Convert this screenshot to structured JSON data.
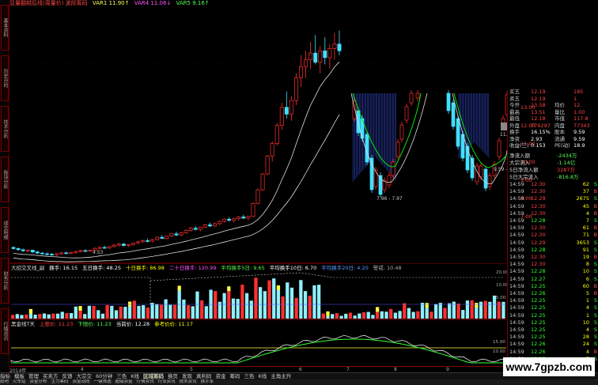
{
  "topbar": {
    "title": "显量翻越后线(周量价)  波段筹码",
    "var1": "VAR1 11.90↑",
    "var4": "VAR4 11.06↓",
    "var5": "VAR5 9.16↑",
    "colors": {
      "title": "#ff4444",
      "var1": "#ffff55",
      "var4": "#ff55ff",
      "var5": "#55ff55"
    }
  },
  "left_strip": [
    "基本资料",
    "历史分时",
    "技术分析",
    "板块分析",
    "成交明细",
    "财务分析",
    "行情资讯"
  ],
  "indicator1": {
    "label": "大招交叉线_副",
    "items": [
      {
        "text": "换手: 16.15",
        "color": "#ffffff"
      },
      {
        "text": "五日换手: 48.25",
        "color": "#ffffff"
      },
      {
        "text": "十日换手: 86.98",
        "color": "#ffff00"
      },
      {
        "text": "二十日换手: 120.99",
        "color": "#ff55ff"
      },
      {
        "text": "平均换手5日: 9.65",
        "color": "#55ff55"
      },
      {
        "text": "平均换手10日: 6.70",
        "color": "#ffffff"
      },
      {
        "text": "平均换手20日: 4.20",
        "color": "#5599ff"
      },
      {
        "text": "警戒: 10.48",
        "color": "#aaaaaa"
      }
    ],
    "yaxis": [
      "20.00",
      "10.00",
      "5.00"
    ]
  },
  "indicator2": {
    "label": "黑金线T天",
    "items": [
      {
        "text": "上限价: 11.23",
        "color": "#ff4444"
      },
      {
        "text": "下限价: 11.23",
        "color": "#55ff55"
      },
      {
        "text": "当前价: 12.28",
        "color": "#ffffff"
      },
      {
        "text": "参考价价: 11.17",
        "color": "#ffff00"
      }
    ],
    "yaxis": [
      "15.00",
      "10.00"
    ]
  },
  "price_labels": [
    "4.53",
    "7.96 - 7.97",
    "11.81 -",
    "9.59 - 9.60"
  ],
  "right_panel": {
    "axis": [
      "13.00",
      "12.00",
      "11.00",
      "10.00",
      "9.00",
      "8.00",
      "7.00"
    ],
    "quote": [
      {
        "l": "买五",
        "v": "12.19",
        "v2": "185",
        "lc": "#ccc",
        "vc": "#f44"
      },
      {
        "l": "卖五",
        "v": "12.19",
        "v2": "1",
        "lc": "#ccc",
        "vc": "#f44"
      },
      {
        "l": "今开",
        "v": "13.58",
        "l2": "均价",
        "v2": "12.",
        "vc": "#f44"
      },
      {
        "l": "最高",
        "v": "13.51",
        "l2": "量比",
        "v2": "1.00",
        "vc": "#f44"
      },
      {
        "l": "最低",
        "v": "12.18",
        "l2": "市值",
        "v2": "117.8",
        "vc": "#f44"
      },
      {
        "l": "外盘",
        "v": "776297",
        "l2": "内盘",
        "v2": "77343",
        "vc": "#f44"
      },
      {
        "l": "换手",
        "v": "16.15%",
        "l2": "股本",
        "v2": "9.59",
        "vc": "#fff"
      },
      {
        "l": "净资",
        "v": "2.93",
        "l2": "流通",
        "v2": "9.59",
        "vc": "#fff"
      },
      {
        "l": "收益(三)",
        "v": "0.153",
        "l2": "PE(动)",
        "v2": "18.9",
        "vc": "#fff"
      }
    ],
    "flows": [
      {
        "l": "净流入额",
        "v": "-2434万",
        "c": "#55ff55"
      },
      {
        "l": "大宗流入",
        "v": "-1.14亿",
        "c": "#55ff55"
      },
      {
        "l": "5日净流入额",
        "v": "3287万",
        "c": "#ff4444"
      },
      {
        "l": "5日大宗流入",
        "v": "-816.8万",
        "c": "#55ff55"
      }
    ],
    "ticks": [
      {
        "t": "14:59",
        "p": "12.30",
        "v": "62",
        "s": "S"
      },
      {
        "t": "14:59",
        "p": "12.30",
        "v": "37",
        "s": "B"
      },
      {
        "t": "14:59",
        "p": "12.29",
        "v": "2675",
        "s": "S"
      },
      {
        "t": "14:59",
        "p": "12.30",
        "v": "45",
        "s": "B"
      },
      {
        "t": "14:59",
        "p": "12.30",
        "v": "4",
        "s": "B"
      },
      {
        "t": "14:59",
        "p": "12.28",
        "v": "7",
        "s": "S"
      },
      {
        "t": "14:59",
        "p": "12.30",
        "v": "61",
        "s": "B"
      },
      {
        "t": "14:59",
        "p": "12.30",
        "v": "71",
        "s": "B"
      },
      {
        "t": "14:59",
        "p": "12.29",
        "v": "3653",
        "s": "S"
      },
      {
        "t": "14:59",
        "p": "12.28",
        "v": "91",
        "s": "S"
      },
      {
        "t": "14:59",
        "p": "12.30",
        "v": "19",
        "s": "B"
      },
      {
        "t": "14:59",
        "p": "12.30",
        "v": "8",
        "s": "S"
      },
      {
        "t": "14:59",
        "p": "12.28",
        "v": "10",
        "s": "S"
      },
      {
        "t": "14:59",
        "p": "12.27",
        "v": "6",
        "s": "S"
      },
      {
        "t": "14:59",
        "p": "12.25",
        "v": "60",
        "s": "B"
      },
      {
        "t": "14:59",
        "p": "12.26",
        "v": "5",
        "s": "B"
      },
      {
        "t": "14:59",
        "p": "12.25",
        "v": "1",
        "s": "S"
      },
      {
        "t": "14:59",
        "p": "12.25",
        "v": "4",
        "s": "S"
      },
      {
        "t": "14:59",
        "p": "12.25",
        "v": "1",
        "s": "S"
      },
      {
        "t": "14:59",
        "p": "12.25",
        "v": "10",
        "s": "S"
      },
      {
        "t": "14:59",
        "p": "12.25",
        "v": "4",
        "s": "S"
      },
      {
        "t": "14:59",
        "p": "12.25",
        "v": "28",
        "s": "S"
      },
      {
        "t": "14:59",
        "p": "12.26",
        "v": "24",
        "s": "S"
      },
      {
        "t": "14:59",
        "p": "12.26",
        "v": "4",
        "s": "B"
      },
      {
        "t": "14:59",
        "p": "12.25",
        "v": "7",
        "s": "S"
      }
    ]
  },
  "xaxis": [
    {
      "label": "2014年",
      "pos": 0.0
    },
    {
      "label": "4",
      "pos": 0.15
    },
    {
      "label": "5",
      "pos": 0.38
    },
    {
      "label": "6",
      "pos": 0.61
    },
    {
      "label": "7",
      "pos": 0.71
    },
    {
      "label": "8",
      "pos": 0.81
    },
    {
      "label": "9",
      "pos": 0.92
    }
  ],
  "tabs": [
    "指标",
    "模板",
    "管理",
    "买卖方",
    "反馈",
    "大宗交",
    "60分钟",
    "三色",
    "K线",
    "区域筹码",
    "换页",
    "发现",
    "真利码",
    "资金",
    "筹码",
    "三色",
    "K线",
    "主角主升"
  ],
  "status": [
    "股吧",
    "火车站",
    "资金分布",
    "主力筹码",
    "资金动向",
    "一键筛选",
    "超级资金",
    "行情资讯",
    "行业资讯",
    "技术资讯",
    "换手率"
  ],
  "watermark": "www.7gpzb.com",
  "chart_data": {
    "type": "candlestick",
    "title": "显量翻越后线(周量价)",
    "note": "price series read approximately from the candles; volume in 换手 units",
    "candles": [
      [
        4.9,
        4.95,
        4.8,
        4.85
      ],
      [
        4.85,
        4.9,
        4.75,
        4.8
      ],
      [
        4.8,
        4.85,
        4.7,
        4.75
      ],
      [
        4.75,
        4.82,
        4.68,
        4.78
      ],
      [
        4.78,
        4.8,
        4.65,
        4.7
      ],
      [
        4.7,
        4.75,
        4.6,
        4.65
      ],
      [
        4.65,
        4.7,
        4.58,
        4.62
      ],
      [
        4.62,
        4.68,
        4.55,
        4.6
      ],
      [
        4.6,
        4.66,
        4.53,
        4.58
      ],
      [
        4.58,
        4.64,
        4.53,
        4.62
      ],
      [
        4.62,
        4.7,
        4.58,
        4.66
      ],
      [
        4.66,
        4.72,
        4.6,
        4.64
      ],
      [
        4.64,
        4.7,
        4.6,
        4.68
      ],
      [
        4.68,
        4.75,
        4.62,
        4.72
      ],
      [
        4.72,
        4.8,
        4.68,
        4.76
      ],
      [
        4.76,
        4.82,
        4.7,
        4.74
      ],
      [
        4.74,
        4.8,
        4.7,
        4.78
      ],
      [
        4.78,
        4.9,
        4.74,
        4.86
      ],
      [
        4.86,
        4.95,
        4.8,
        4.9
      ],
      [
        4.9,
        4.98,
        4.84,
        4.88
      ],
      [
        4.88,
        4.96,
        4.82,
        4.94
      ],
      [
        4.94,
        5.05,
        4.9,
        5.0
      ],
      [
        5.0,
        5.1,
        4.95,
        5.05
      ],
      [
        5.05,
        5.1,
        4.96,
        4.98
      ],
      [
        4.98,
        5.05,
        4.92,
        5.02
      ],
      [
        5.02,
        5.12,
        4.98,
        5.1
      ],
      [
        5.1,
        5.2,
        5.05,
        5.15
      ],
      [
        5.15,
        5.25,
        5.1,
        5.2
      ],
      [
        5.2,
        5.3,
        5.12,
        5.18
      ],
      [
        5.18,
        5.28,
        5.12,
        5.25
      ],
      [
        5.25,
        5.4,
        5.2,
        5.35
      ],
      [
        5.35,
        5.45,
        5.28,
        5.3
      ],
      [
        5.3,
        5.42,
        5.25,
        5.4
      ],
      [
        5.4,
        5.55,
        5.35,
        5.5
      ],
      [
        5.5,
        5.6,
        5.4,
        5.45
      ],
      [
        5.45,
        5.58,
        5.4,
        5.55
      ],
      [
        5.55,
        5.7,
        5.5,
        5.65
      ],
      [
        5.65,
        5.8,
        5.6,
        5.75
      ],
      [
        5.75,
        5.85,
        5.65,
        5.7
      ],
      [
        5.7,
        5.82,
        5.62,
        5.8
      ],
      [
        5.8,
        5.95,
        5.75,
        5.9
      ],
      [
        5.9,
        6.0,
        5.8,
        5.85
      ],
      [
        5.85,
        6.0,
        5.8,
        5.95
      ],
      [
        5.95,
        6.1,
        5.9,
        6.05
      ],
      [
        6.05,
        6.2,
        6.0,
        6.15
      ],
      [
        6.15,
        6.25,
        6.05,
        6.1
      ],
      [
        6.1,
        6.2,
        6.0,
        6.18
      ],
      [
        6.18,
        6.3,
        6.1,
        6.25
      ],
      [
        6.25,
        6.35,
        6.15,
        6.2
      ],
      [
        6.2,
        6.3,
        6.1,
        6.28
      ],
      [
        6.28,
        6.9,
        6.25,
        6.85
      ],
      [
        6.85,
        7.5,
        6.8,
        7.45
      ],
      [
        7.45,
        8.2,
        7.4,
        8.15
      ],
      [
        8.15,
        9.0,
        8.1,
        8.95
      ],
      [
        8.95,
        9.6,
        8.7,
        9.5
      ],
      [
        9.5,
        10.4,
        9.4,
        10.3
      ],
      [
        10.3,
        11.3,
        10.1,
        11.1
      ],
      [
        11.1,
        11.8,
        10.6,
        10.8
      ],
      [
        10.8,
        11.6,
        10.5,
        11.4
      ],
      [
        11.4,
        12.6,
        11.2,
        12.4
      ],
      [
        12.4,
        13.4,
        12.0,
        12.9
      ],
      [
        12.9,
        13.6,
        12.4,
        13.2
      ],
      [
        13.2,
        14.0,
        12.8,
        13.5
      ],
      [
        13.5,
        14.3,
        13.0,
        13.1
      ],
      [
        13.1,
        13.8,
        12.6,
        13.6
      ],
      [
        13.6,
        14.2,
        13.0,
        13.3
      ],
      [
        13.3,
        13.9,
        12.8,
        13.7
      ],
      [
        13.7,
        14.4,
        13.2,
        13.9
      ],
      [
        13.9,
        14.5,
        13.4,
        13.6
      ]
    ],
    "volume": [
      3,
      2,
      2,
      3,
      2,
      2,
      3,
      2,
      2,
      3,
      4,
      3,
      3,
      4,
      5,
      4,
      3,
      5,
      6,
      5,
      4,
      6,
      7,
      6,
      5,
      6,
      8,
      7,
      6,
      8,
      9,
      7,
      8,
      10,
      8,
      7,
      9,
      11,
      9,
      8,
      10,
      12,
      10,
      9,
      12,
      14,
      11,
      10,
      13,
      12,
      16,
      15,
      14,
      13,
      17,
      16,
      18,
      15,
      19,
      17,
      18,
      16,
      17,
      15,
      16,
      14,
      15,
      13,
      16
    ]
  }
}
